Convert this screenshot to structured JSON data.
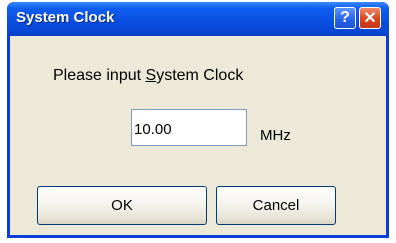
{
  "window": {
    "title": "System Clock",
    "help_glyph": "?",
    "close_glyph": "✕"
  },
  "prompt": {
    "before": "Please input ",
    "mnemonic": "S",
    "after": "ystem Clock"
  },
  "clock_input": {
    "value": "10.00"
  },
  "unit_label": "MHz",
  "buttons": {
    "ok": "OK",
    "cancel": "Cancel"
  },
  "colors": {
    "titlebar": "#0a4fe0",
    "dialog_background": "#ece9d8",
    "close_button": "#d8431e"
  },
  "icons": [
    "help-icon",
    "close-icon"
  ]
}
